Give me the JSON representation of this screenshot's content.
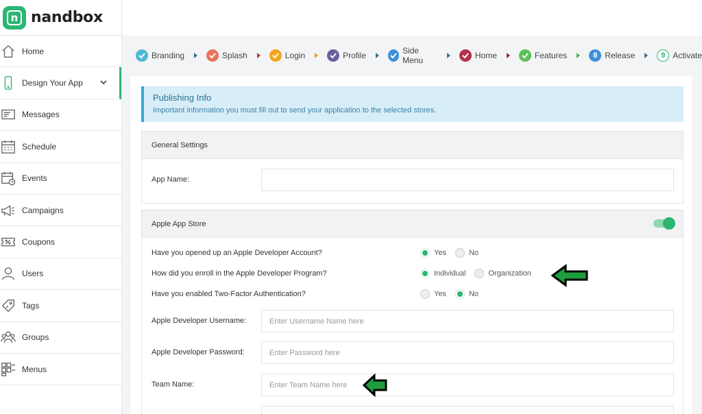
{
  "brand": {
    "name": "nandbox",
    "logo_letter": "n",
    "color": "#2bb673"
  },
  "sidebar": {
    "items": [
      {
        "label": "Home",
        "icon": "home-icon"
      },
      {
        "label": "Design Your App",
        "icon": "phone-icon",
        "active": true
      },
      {
        "label": "Messages",
        "icon": "message-icon"
      },
      {
        "label": "Schedule",
        "icon": "calendar-icon"
      },
      {
        "label": "Events",
        "icon": "event-calendar-icon"
      },
      {
        "label": "Campaigns",
        "icon": "megaphone-icon"
      },
      {
        "label": "Coupons",
        "icon": "coupon-icon"
      },
      {
        "label": "Users",
        "icon": "user-icon"
      },
      {
        "label": "Tags",
        "icon": "tag-icon"
      },
      {
        "label": "Groups",
        "icon": "group-icon"
      },
      {
        "label": "Menus",
        "icon": "menu-grid-icon"
      }
    ]
  },
  "steps": [
    {
      "label": "Branding",
      "state": "done",
      "color": "#4fb8d4"
    },
    {
      "label": "Splash",
      "state": "done",
      "color": "#e8735a"
    },
    {
      "label": "Login",
      "state": "done",
      "color": "#f2a51f"
    },
    {
      "label": "Profile",
      "state": "done",
      "color": "#6a5e9b"
    },
    {
      "label": "Side Menu",
      "state": "done",
      "color": "#3f8fd9"
    },
    {
      "label": "Home",
      "state": "done",
      "color": "#b3334b"
    },
    {
      "label": "Features",
      "state": "done",
      "color": "#5cc15a"
    },
    {
      "label": "Release",
      "state": "number",
      "number": "8",
      "color": "#3f8fd9"
    },
    {
      "label": "Activate",
      "state": "outline",
      "number": "9",
      "color": "#2bb673"
    }
  ],
  "info": {
    "title": "Publishing Info",
    "text": "Important information you must fill out to send your application to the selected stores."
  },
  "general": {
    "title": "General Settings",
    "app_name_label": "App Name:",
    "app_name_value": ""
  },
  "apple": {
    "title": "Apple App Store",
    "enabled": true,
    "q1": {
      "label": "Have you opened up an Apple Developer Account?",
      "options": [
        "Yes",
        "No"
      ],
      "selected": "Yes"
    },
    "q2": {
      "label": "How did you enroll in the Apple Developer Program?",
      "options": [
        "Individual",
        "Organization"
      ],
      "selected": "Individual"
    },
    "q3": {
      "label": "Have you enabled Two-Factor Authentication?",
      "options": [
        "Yes",
        "No"
      ],
      "selected": "No"
    },
    "username": {
      "label": "Apple Developer Username:",
      "placeholder": "Enter Username Name here"
    },
    "password": {
      "label": "Apple Developer Password:",
      "placeholder": "Enter Password here"
    },
    "team": {
      "label": "Team Name:",
      "placeholder": "Enter Team Name here"
    }
  }
}
